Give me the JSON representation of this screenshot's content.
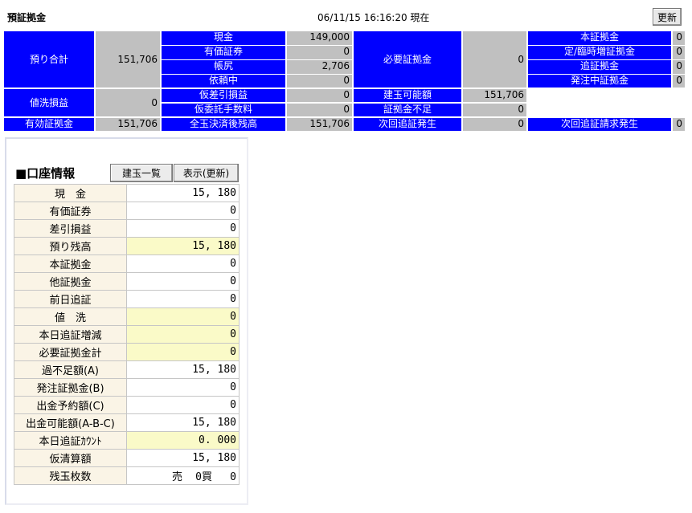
{
  "header": {
    "title": "預証拠金",
    "timestamp": "06/11/15 16:16:20 現在",
    "refresh_label": "更新"
  },
  "summary": {
    "azukari_label": "預り合計",
    "azukari_value": "151,706",
    "genkin_label": "現金",
    "genkin_value": "149,000",
    "yuka_label": "有価証券",
    "yuka_value": "0",
    "chojiri_label": "帳尻",
    "chojiri_value": "2,706",
    "irai_label": "依頼中",
    "irai_value": "0",
    "hitsuyo_label": "必要証拠金",
    "hitsuyo_value": "0",
    "hon_label": "本証拠金",
    "hon_value": "0",
    "rinji_label": "定/臨時増証拠金",
    "rinji_value": "0",
    "oi_label": "追証拠金",
    "oi_value": "0",
    "hatchu_label": "発注中証拠金",
    "hatchu_value": "0",
    "nearai_label": "値洗損益",
    "nearai_value": "0",
    "karisa_label": "仮差引損益",
    "karisa_value": "0",
    "karitesu_label": "仮委託手数料",
    "karitesu_value": "0",
    "tategyoku_label": "建玉可能額",
    "tategyoku_value": "151,706",
    "fusoku_label": "証拠金不足",
    "fusoku_value": "0",
    "yuko_label": "有効証拠金",
    "yuko_value": "151,706",
    "zengyoku_label": "全玉決済後残高",
    "zengyoku_value": "151,706",
    "jikai_label": "次回追証発生",
    "jikai_value": "0",
    "jikai_seikyu_label": "次回追証請求発生",
    "jikai_seikyu_value": "0"
  },
  "account": {
    "title": "■口座情報",
    "btn_list": "建玉一覧",
    "btn_display": "表示(更新)",
    "rows": [
      {
        "label": "現　金",
        "value": "15, 180"
      },
      {
        "label": "有価証券",
        "value": "0"
      },
      {
        "label": "差引損益",
        "value": "0"
      },
      {
        "label": "預り残高",
        "value": "15, 180"
      },
      {
        "label": "本証拠金",
        "value": "0"
      },
      {
        "label": "他証拠金",
        "value": "0"
      },
      {
        "label": "前日追証",
        "value": "0"
      },
      {
        "label": "値　洗",
        "value": "0"
      },
      {
        "label": "本日追証増減",
        "value": "0"
      },
      {
        "label": "必要証拠金計",
        "value": "0"
      },
      {
        "label": "過不足額(A)",
        "value": "15, 180"
      },
      {
        "label": "発注証拠金(B)",
        "value": "0"
      },
      {
        "label": "出金予約額(C)",
        "value": "0"
      },
      {
        "label": "出金可能額(A-B-C)",
        "value": "15, 180"
      },
      {
        "label": "本日追証ｶｳﾝﾄ",
        "value": "0. 000"
      },
      {
        "label": "仮清算額",
        "value": "15, 180"
      },
      {
        "label": "残玉枚数",
        "sell_label": "売",
        "sell_value": "0",
        "buy_label": "買",
        "buy_value": "0"
      }
    ]
  },
  "colors": {
    "header_blue": "#0000ff",
    "value_gray": "#c0c0c0",
    "label_beige": "#faf4e6",
    "highlight_yellow": "#fafac8"
  }
}
